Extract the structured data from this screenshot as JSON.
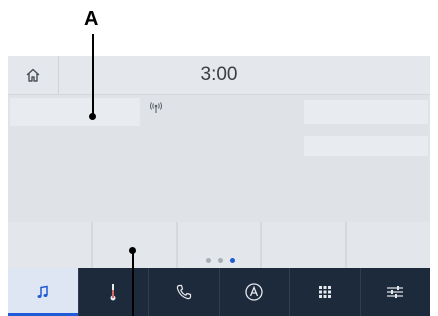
{
  "callout": {
    "label": "A"
  },
  "status_bar": {
    "time": "3:00",
    "home_icon": "home-icon"
  },
  "content": {
    "signal_icon": "radio-signal-icon"
  },
  "pager": {
    "pages": 3,
    "active_index": 2
  },
  "nav": {
    "items": [
      {
        "name": "audio",
        "icon": "music-note-icon",
        "active": true
      },
      {
        "name": "climate",
        "icon": "thermometer-icon",
        "active": false
      },
      {
        "name": "phone",
        "icon": "phone-icon",
        "active": false
      },
      {
        "name": "navigation",
        "icon": "navigation-a-icon",
        "active": false
      },
      {
        "name": "apps",
        "icon": "apps-grid-icon",
        "active": false
      },
      {
        "name": "settings",
        "icon": "sliders-icon",
        "active": false
      }
    ]
  },
  "colors": {
    "nav_background": "#1d2a3b",
    "accent": "#1f5bd6",
    "screen_background": "#dfe2e7"
  }
}
